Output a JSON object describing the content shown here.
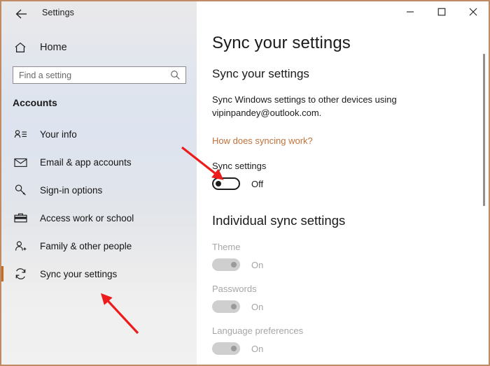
{
  "window": {
    "app_title": "Settings",
    "back_icon": "back-arrow-icon",
    "controls": {
      "minimize": "minimize-icon",
      "maximize": "maximize-icon",
      "close": "close-icon"
    },
    "border_color": "#c08a62"
  },
  "sidebar": {
    "home_label": "Home",
    "home_icon": "home-icon",
    "search": {
      "placeholder": "Find a setting",
      "value": "",
      "icon": "search-icon"
    },
    "section_title": "Accounts",
    "items": [
      {
        "label": "Your info",
        "icon": "your-info-icon",
        "selected": false
      },
      {
        "label": "Email & app accounts",
        "icon": "envelope-icon",
        "selected": false
      },
      {
        "label": "Sign-in options",
        "icon": "key-icon",
        "selected": false
      },
      {
        "label": "Access work or school",
        "icon": "briefcase-icon",
        "selected": false
      },
      {
        "label": "Family & other people",
        "icon": "person-add-icon",
        "selected": false
      },
      {
        "label": "Sync your settings",
        "icon": "sync-icon",
        "selected": true
      }
    ],
    "accent_color": "#c26a28"
  },
  "main": {
    "page_title": "Sync your settings",
    "sub_heading": "Sync your settings",
    "description": "Sync Windows settings to other devices using vipinpandey@outlook.com.",
    "help_link": "How does syncing work?",
    "help_link_color": "#c2703a",
    "sync_toggle": {
      "label": "Sync settings",
      "state": "Off",
      "enabled": true
    },
    "group_heading": "Individual sync settings",
    "individual": [
      {
        "label": "Theme",
        "state": "On",
        "enabled": false
      },
      {
        "label": "Passwords",
        "state": "On",
        "enabled": false
      },
      {
        "label": "Language preferences",
        "state": "On",
        "enabled": false
      }
    ]
  },
  "annotations": {
    "color": "#ec1c1c",
    "arrow_to_toggle": "red-arrow-pointing-to-sync-toggle",
    "arrow_to_sidebar": "red-arrow-pointing-to-sync-your-settings"
  }
}
